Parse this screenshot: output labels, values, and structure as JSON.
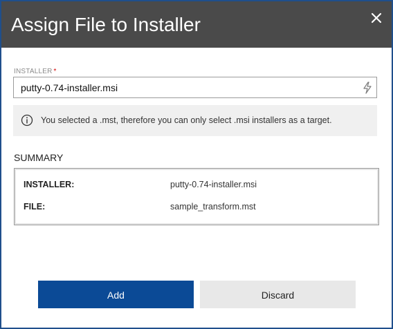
{
  "dialog": {
    "title": "Assign File to Installer"
  },
  "installer": {
    "label": "INSTALLER",
    "required_marker": "*",
    "value": "putty-0.74-installer.msi"
  },
  "info": {
    "message": "You selected a .mst, therefore you can only select .msi installers as a target."
  },
  "summary": {
    "title": "SUMMARY",
    "rows": [
      {
        "key": "INSTALLER:",
        "value": "putty-0.74-installer.msi"
      },
      {
        "key": "FILE:",
        "value": "sample_transform.mst"
      }
    ]
  },
  "actions": {
    "add_label": "Add",
    "discard_label": "Discard"
  },
  "colors": {
    "header_bg": "#4a4a4a",
    "dialog_border": "#1f4f8c",
    "primary_button": "#0b4a96",
    "secondary_button": "#e8e8e8",
    "info_bg": "#f0f0f0",
    "required": "#d20000"
  },
  "icons": {
    "close": "close-icon",
    "bolt": "lightning-icon",
    "info": "info-icon"
  }
}
